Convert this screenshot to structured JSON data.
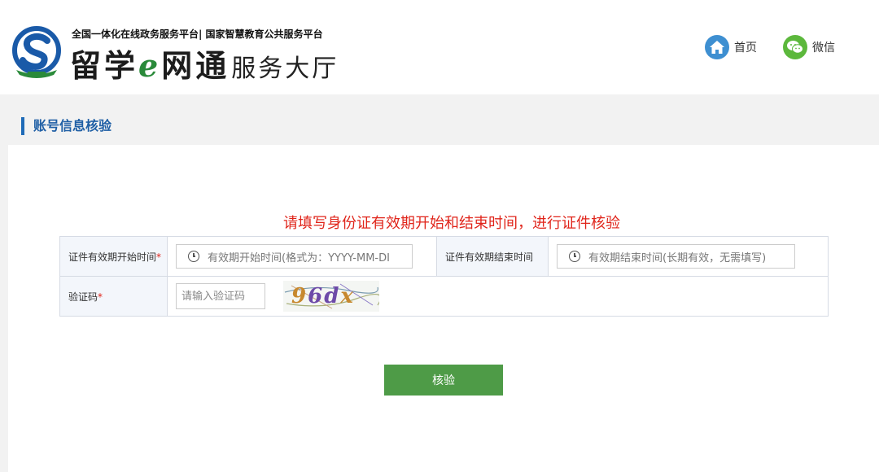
{
  "header": {
    "slogan": "全国一体化在线政务服务平台| 国家智慧教育公共服务平台",
    "brand_main_1": "留学",
    "brand_main_e": "e",
    "brand_main_2": "网通",
    "brand_sub": "服务大厅",
    "nav": {
      "home_label": "首页",
      "wechat_label": "微信"
    }
  },
  "page": {
    "section_title": "账号信息核验",
    "notice": "请填写身份证有效期开始和结束时间，进行证件核验"
  },
  "form": {
    "start_label": "证件有效期开始时间",
    "start_required": "*",
    "start_placeholder": "有效期开始时间(格式为：YYYY-MM-DI",
    "end_label": "证件有效期结束时间",
    "end_placeholder": "有效期结束时间(长期有效，无需填写)",
    "captcha_label": "验证码",
    "captcha_required": "*",
    "captcha_placeholder": "请输入验证码",
    "captcha_text": [
      "9",
      "6",
      "d",
      "x"
    ]
  },
  "actions": {
    "verify_label": "核验"
  },
  "icons": {
    "home": "home-icon",
    "wechat": "wechat-icon",
    "clock": "clock-icon"
  },
  "colors": {
    "accent_blue": "#1f6bb8",
    "notice_red": "#e0251b",
    "button_green": "#4e9b47",
    "wechat_green": "#5cb83c",
    "home_blue": "#3e8fd1"
  }
}
